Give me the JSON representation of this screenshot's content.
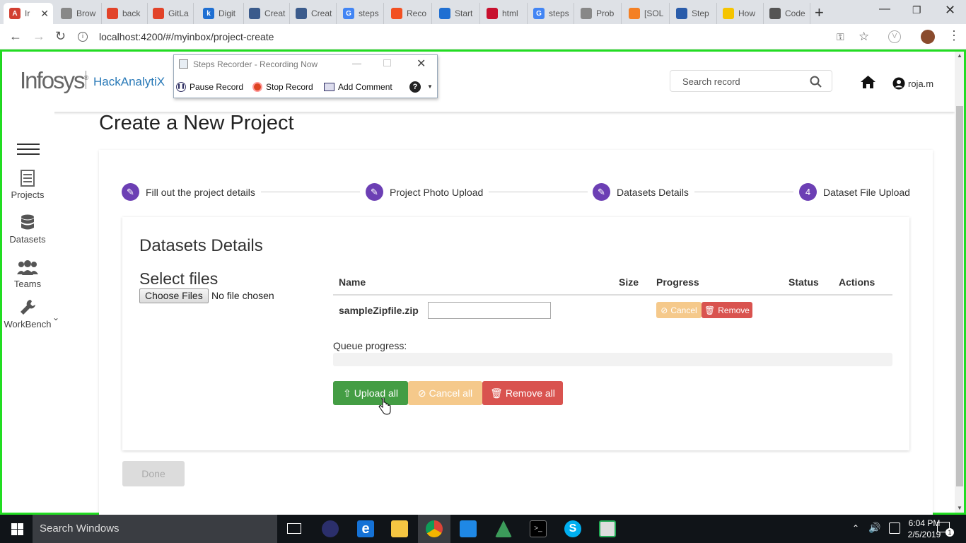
{
  "browser": {
    "tabs": [
      {
        "label": "Ir",
        "color": "#d23f31",
        "glyph": "A"
      },
      {
        "label": "Brow",
        "color": "#888",
        "glyph": ""
      },
      {
        "label": "back",
        "color": "#e24329",
        "glyph": ""
      },
      {
        "label": "GitLa",
        "color": "#e24329",
        "glyph": ""
      },
      {
        "label": "Digit",
        "color": "#1f6fd2",
        "glyph": "k"
      },
      {
        "label": "Creat",
        "color": "#3b5b8c",
        "glyph": ""
      },
      {
        "label": "Creat",
        "color": "#3b5b8c",
        "glyph": ""
      },
      {
        "label": "steps",
        "color": "#4285f4",
        "glyph": "G"
      },
      {
        "label": "Reco",
        "color": "#f25022",
        "glyph": ""
      },
      {
        "label": "Start",
        "color": "#1f6fd2",
        "glyph": ""
      },
      {
        "label": "html",
        "color": "#c8102e",
        "glyph": ""
      },
      {
        "label": "steps",
        "color": "#4285f4",
        "glyph": "G"
      },
      {
        "label": "Prob",
        "color": "#888",
        "glyph": ""
      },
      {
        "label": "[SOL",
        "color": "#f48024",
        "glyph": ""
      },
      {
        "label": "Step",
        "color": "#2a5caa",
        "glyph": ""
      },
      {
        "label": "How",
        "color": "#f5c400",
        "glyph": ""
      },
      {
        "label": "Code",
        "color": "#555",
        "glyph": ""
      }
    ],
    "url": "localhost:4200/#/myinbox/project-create"
  },
  "recorder": {
    "title": "Steps Recorder - Recording Now",
    "pause": "Pause Record",
    "stop": "Stop Record",
    "comment": "Add Comment"
  },
  "header": {
    "logo": "Infosys",
    "brand": "HackAnalytiX",
    "search_placeholder": "Search record",
    "user": "roja.m"
  },
  "sidebar": {
    "items": [
      {
        "label": "Projects"
      },
      {
        "label": "Datasets"
      },
      {
        "label": "Teams"
      },
      {
        "label": "WorkBench"
      }
    ]
  },
  "page": {
    "title": "Create a New Project",
    "steps": [
      {
        "label": "Fill out the project details",
        "marker": "✎"
      },
      {
        "label": "Project Photo Upload",
        "marker": "✎"
      },
      {
        "label": "Datasets Details",
        "marker": "✎"
      },
      {
        "label": "Dataset File Upload",
        "marker": "4"
      }
    ],
    "section_title": "Datasets Details",
    "select_files": "Select files",
    "choose_files": "Choose Files",
    "no_file": "No file chosen",
    "table": {
      "columns": [
        "Name",
        "Size",
        "Progress",
        "Status",
        "Actions"
      ],
      "rows": [
        {
          "name": "sampleZipfile.zip",
          "cancel": "Cancel",
          "remove": "Remove"
        }
      ]
    },
    "queue_label": "Queue progress:",
    "upload_all": "Upload all",
    "cancel_all": "Cancel all",
    "remove_all": "Remove all",
    "done": "Done"
  },
  "taskbar": {
    "search": "Search Windows",
    "time": "6:04 PM",
    "date": "2/5/2019",
    "notifications": "1"
  },
  "colors": {
    "step_accent": "#6c3fb4",
    "upload": "#449d44",
    "cancel": "#f0ad4e",
    "remove": "#d9534f",
    "frame": "#22dd22"
  }
}
